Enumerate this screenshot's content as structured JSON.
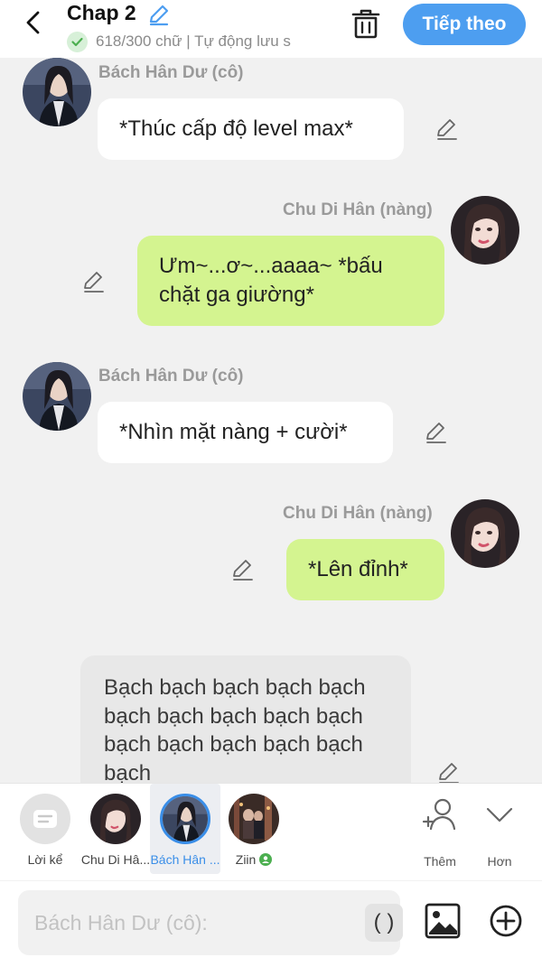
{
  "header": {
    "title": "Chap 2",
    "status": "618/300 chữ | Tự động lưu s",
    "next_label": "Tiếp theo"
  },
  "messages": [
    {
      "side": "left",
      "speaker": "Bách Hân Dư (cô)",
      "text": "*Thúc cấp độ level max*"
    },
    {
      "side": "right",
      "speaker": "Chu Di Hân (nàng)",
      "text": "Ưm~...ơ~...aaaa~ *bấu chặt ga giường*"
    },
    {
      "side": "left",
      "speaker": "Bách Hân Dư (cô)",
      "text": "*Nhìn mặt nàng + cười*"
    },
    {
      "side": "right",
      "speaker": "Chu Di Hân (nàng)",
      "text": "*Lên đỉnh*"
    }
  ],
  "narration": {
    "text": "Bạch bạch bạch bạch bạch bạch bạch bạch bạch bạch bạch bạch bạch bạch bạch bạch"
  },
  "characters": [
    {
      "label": "Lời kể"
    },
    {
      "label": "Chu Di Hâ..."
    },
    {
      "label": "Bách Hân ..."
    },
    {
      "label": "Ziin"
    }
  ],
  "tools": {
    "more_label": "Thêm",
    "collapse_label": "Hơn"
  },
  "input": {
    "placeholder": "Bách Hân Dư (cô):",
    "paren_label": "( )"
  },
  "colors": {
    "accent": "#4d9ef0",
    "right_bubble": "#d4f490",
    "left_bubble": "#ffffff",
    "background": "#f1f1f1"
  }
}
